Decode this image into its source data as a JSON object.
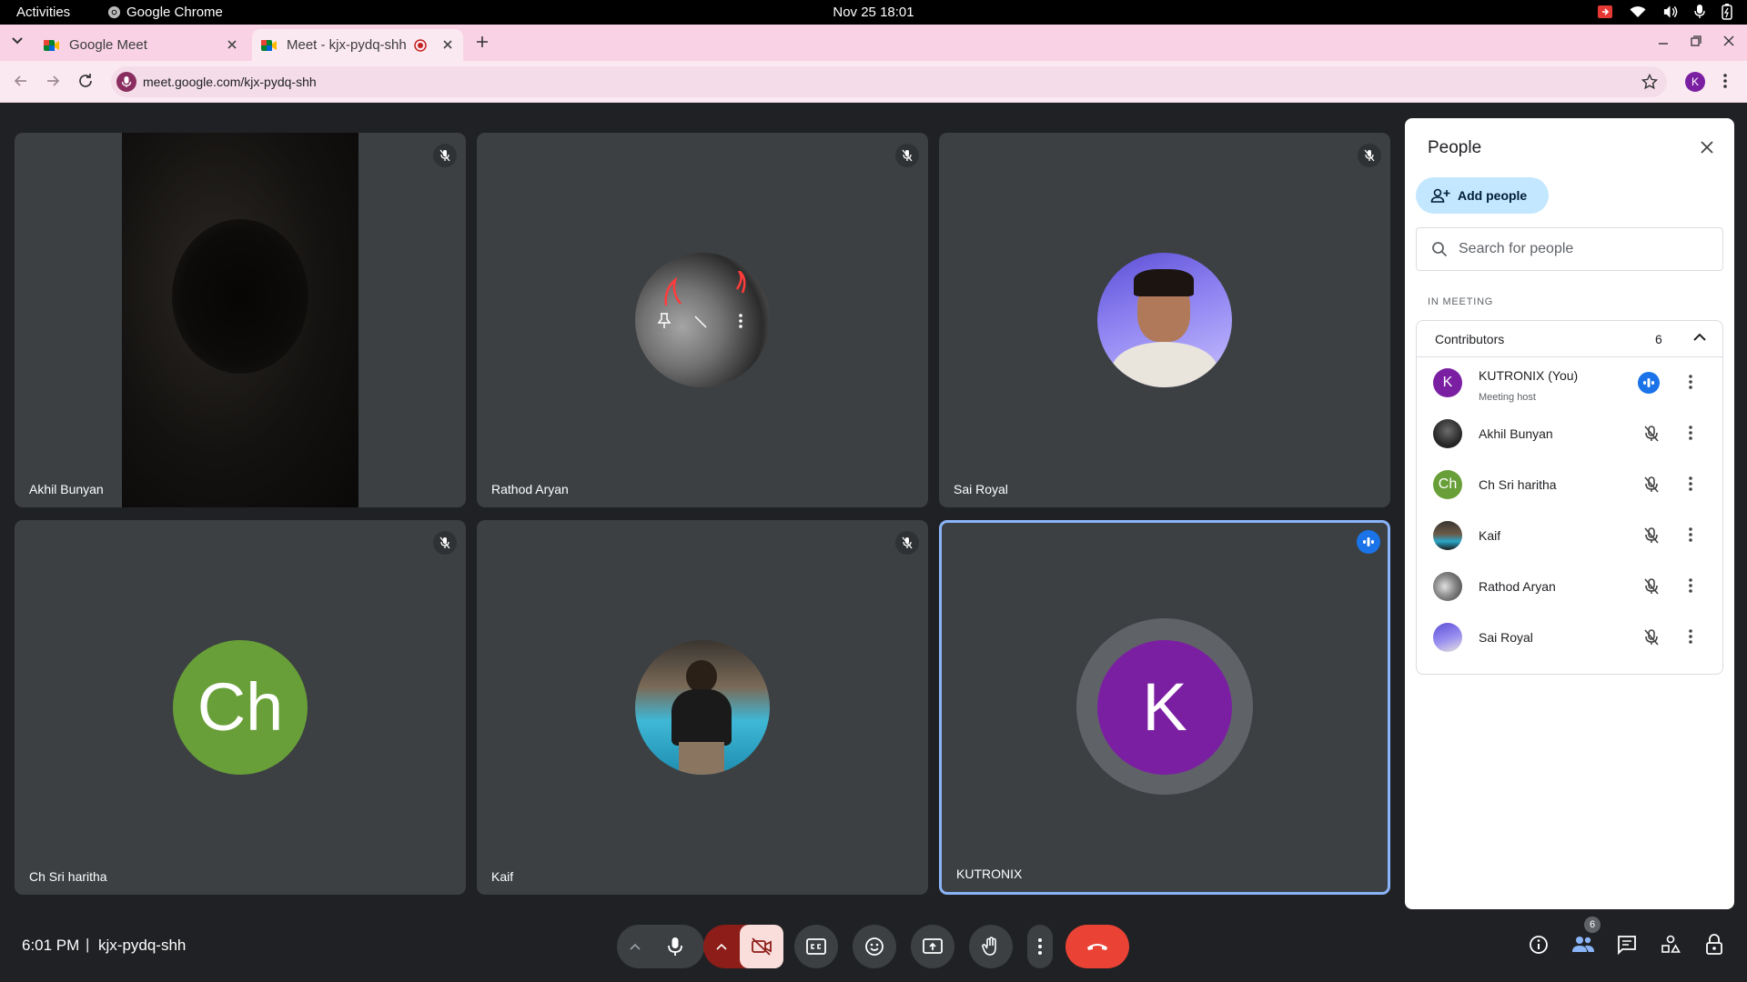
{
  "os_bar": {
    "activities": "Activities",
    "app_name": "Google Chrome",
    "datetime": "Nov 25  18:01"
  },
  "browser": {
    "tabs": [
      {
        "title": "Google Meet",
        "active": false
      },
      {
        "title": "Meet - kjx-pydq-shh",
        "active": true
      }
    ],
    "url": "meet.google.com/kjx-pydq-shh",
    "profile_initial": "K"
  },
  "tiles": [
    {
      "name": "Akhil Bunyan",
      "type": "video"
    },
    {
      "name": "Rathod Aryan",
      "type": "photo"
    },
    {
      "name": "Sai Royal",
      "type": "photo"
    },
    {
      "name": "Ch Sri haritha",
      "type": "initials",
      "initials": "Ch",
      "color": "#689f38"
    },
    {
      "name": "Kaif",
      "type": "photo"
    },
    {
      "name": "KUTRONIX",
      "type": "initials",
      "initials": "K",
      "color": "#7b1fa2",
      "speaking": true
    }
  ],
  "people_panel": {
    "title": "People",
    "add_people_label": "Add people",
    "search_placeholder": "Search for people",
    "section_label": "IN MEETING",
    "group_label": "Contributors",
    "group_count": "6",
    "participants": [
      {
        "name": "KUTRONIX (You)",
        "subtitle": "Meeting host",
        "initial": "K",
        "color": "#7b1fa2",
        "speaking": true
      },
      {
        "name": "Akhil Bunyan",
        "initial": "",
        "color": "#3a3a3a"
      },
      {
        "name": "Ch Sri haritha",
        "initial": "Ch",
        "color": "#689f38"
      },
      {
        "name": "Kaif",
        "initial": "",
        "color": "#4e7a8c"
      },
      {
        "name": "Rathod Aryan",
        "initial": "",
        "color": "#8c8c8c"
      },
      {
        "name": "Sai Royal",
        "initial": "",
        "color": "#6a5fc1"
      }
    ]
  },
  "bottom_bar": {
    "time": "6:01 PM",
    "separator": "|",
    "meeting_code": "kjx-pydq-shh",
    "people_count": "6"
  },
  "colors": {
    "accent_blue": "#1a73e8",
    "end_call_red": "#ea4335",
    "tab_strip": "#f9d3e5"
  }
}
